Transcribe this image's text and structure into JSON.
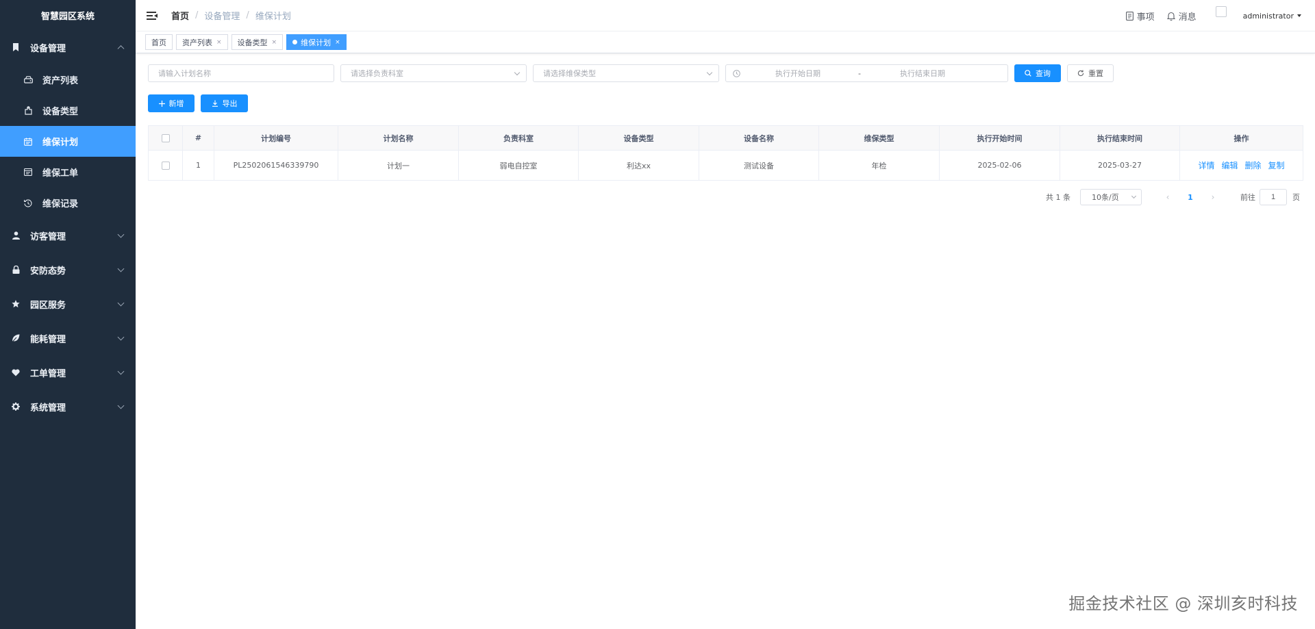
{
  "app": {
    "title": "智慧园区系统"
  },
  "sidebar": {
    "groups": [
      {
        "label": "设备管理",
        "icon": "bookmark-icon",
        "open": true,
        "items": [
          {
            "label": "资产列表",
            "icon": "drive-icon"
          },
          {
            "label": "设备类型",
            "icon": "component-icon"
          },
          {
            "label": "维保计划",
            "icon": "calendar-icon",
            "active": true
          },
          {
            "label": "维保工单",
            "icon": "form-icon"
          },
          {
            "label": "维保记录",
            "icon": "history-icon"
          }
        ]
      },
      {
        "label": "访客管理",
        "icon": "user-icon"
      },
      {
        "label": "安防态势",
        "icon": "lock-icon"
      },
      {
        "label": "园区服务",
        "icon": "star-icon"
      },
      {
        "label": "能耗管理",
        "icon": "leaf-icon"
      },
      {
        "label": "工单管理",
        "icon": "heart-icon"
      },
      {
        "label": "系统管理",
        "icon": "gear-icon"
      }
    ]
  },
  "navbar": {
    "breadcrumb": [
      "首页",
      "设备管理",
      "维保计划"
    ],
    "matters_label": "事项",
    "messages_label": "消息",
    "username": "administrator"
  },
  "tags": [
    {
      "label": "首页",
      "closable": false
    },
    {
      "label": "资产列表",
      "closable": true
    },
    {
      "label": "设备类型",
      "closable": true
    },
    {
      "label": "维保计划",
      "closable": true,
      "active": true
    }
  ],
  "filters": {
    "plan_name_placeholder": "请输入计划名称",
    "department_placeholder": "请选择负责科室",
    "maintenance_type_placeholder": "请选择维保类型",
    "start_date_placeholder": "执行开始日期",
    "range_separator": "-",
    "end_date_placeholder": "执行结束日期",
    "search_label": "查询",
    "reset_label": "重置"
  },
  "actions": {
    "add_label": "新增",
    "export_label": "导出"
  },
  "table": {
    "columns": [
      "#",
      "计划编号",
      "计划名称",
      "负责科室",
      "设备类型",
      "设备名称",
      "维保类型",
      "执行开始时间",
      "执行结束时间",
      "操作"
    ],
    "rows": [
      {
        "index": "1",
        "plan_no": "PL2502061546339790",
        "plan_name": "计划一",
        "department": "弱电自控室",
        "device_type": "利达xx",
        "device_name": "测试设备",
        "maintenance_type": "年检",
        "start": "2025-02-06",
        "end": "2025-03-27"
      }
    ],
    "row_actions": {
      "detail": "详情",
      "edit": "编辑",
      "delete": "删除",
      "copy": "复制"
    }
  },
  "pagination": {
    "total_text": "共 1 条",
    "page_size": "10条/页",
    "prev": "‹",
    "current": "1",
    "next": "›",
    "goto_prefix": "前往",
    "goto_value": "1",
    "goto_suffix": "页"
  },
  "watermark": "掘金技术社区 @ 深圳亥时科技",
  "colors": {
    "sidebar_bg": "#1f2d3d",
    "accent": "#409eff",
    "primary_button": "#1890ff"
  }
}
